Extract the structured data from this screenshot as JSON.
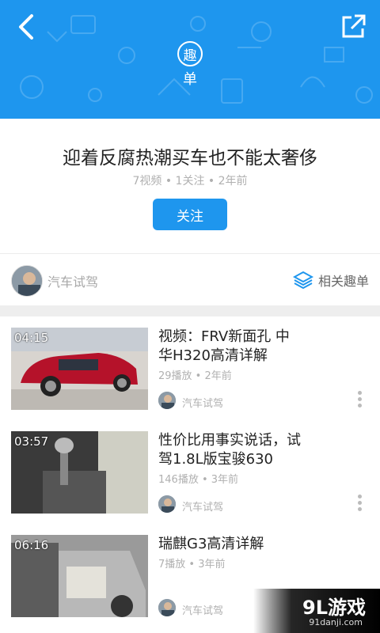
{
  "header": {
    "badge_char": "趣",
    "badge_sub": "单"
  },
  "topic": {
    "title": "迎着反腐热潮买车也不能太奢侈",
    "meta": "7视频 • 1关注 • 2年前",
    "follow_label": "关注"
  },
  "author_bar": {
    "name": "汽车试驾",
    "related_label": "相关趣单"
  },
  "items": [
    {
      "duration": "04:15",
      "title_line1": "视频：FRV新面孔 中",
      "title_line2": "华H320高清详解",
      "meta": "29播放 • 2年前",
      "author": "汽车试驾"
    },
    {
      "duration": "03:57",
      "title_line1": "性价比用事实说话，试",
      "title_line2": "驾1.8L版宝骏630",
      "meta": "146播放 • 3年前",
      "author": "汽车试驾"
    },
    {
      "duration": "06:16",
      "title_line1": "瑞麒G3高清详解",
      "title_line2": "",
      "meta": "7播放 • 3年前",
      "author": "汽车试驾"
    }
  ],
  "watermark": {
    "logo": "9L游戏",
    "url": "91danji.com"
  },
  "colors": {
    "accent": "#1e96ee"
  }
}
